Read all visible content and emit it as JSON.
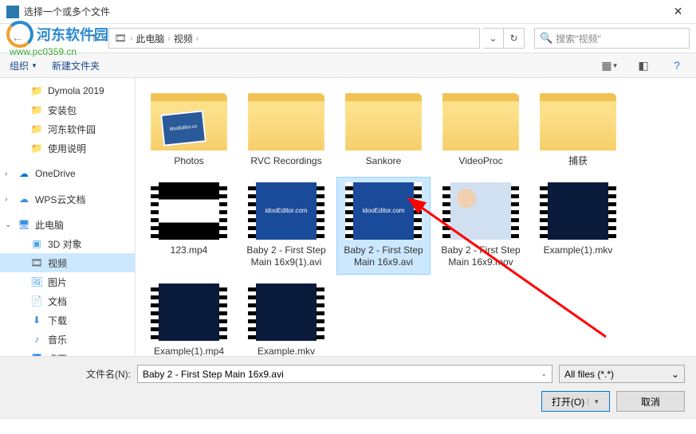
{
  "window": {
    "title": "选择一个或多个文件"
  },
  "watermark": {
    "brand": "河东软件园",
    "url": "www.pc0359.cn"
  },
  "address": {
    "seg1": "此电脑",
    "seg2": "视频",
    "search_placeholder": "搜索\"视频\""
  },
  "toolbar": {
    "organize": "组织",
    "newfolder": "新建文件夹"
  },
  "sidebar": {
    "items": [
      {
        "label": "Dymola 2019",
        "icon": "folder",
        "indent": true,
        "chev": ""
      },
      {
        "label": "安装包",
        "icon": "folder",
        "indent": true,
        "chev": ""
      },
      {
        "label": "河东软件园",
        "icon": "folder",
        "indent": true,
        "chev": ""
      },
      {
        "label": "使用说明",
        "icon": "folder",
        "indent": true,
        "chev": ""
      },
      {
        "label": "OneDrive",
        "icon": "onedrive",
        "indent": false,
        "chev": "›"
      },
      {
        "label": "WPS云文档",
        "icon": "wps",
        "indent": false,
        "chev": "›"
      },
      {
        "label": "此电脑",
        "icon": "pc",
        "indent": false,
        "chev": "⌄"
      },
      {
        "label": "3D 对象",
        "icon": "obj3d",
        "indent": true,
        "chev": ""
      },
      {
        "label": "视频",
        "icon": "video",
        "indent": true,
        "chev": "",
        "sel": true
      },
      {
        "label": "图片",
        "icon": "pic",
        "indent": true,
        "chev": ""
      },
      {
        "label": "文档",
        "icon": "doc",
        "indent": true,
        "chev": ""
      },
      {
        "label": "下载",
        "icon": "dl",
        "indent": true,
        "chev": ""
      },
      {
        "label": "音乐",
        "icon": "music",
        "indent": true,
        "chev": ""
      },
      {
        "label": "桌面",
        "icon": "desktop",
        "indent": true,
        "chev": ""
      }
    ]
  },
  "files": [
    {
      "label": "Photos",
      "type": "folder",
      "preview": "idooEditor.co"
    },
    {
      "label": "RVC Recordings",
      "type": "folder-plain"
    },
    {
      "label": "Sankore",
      "type": "folder-plain"
    },
    {
      "label": "VideoProc",
      "type": "folder",
      "preview": ""
    },
    {
      "label": "捕获",
      "type": "folder-plain"
    },
    {
      "label": "123.mp4",
      "type": "video-light"
    },
    {
      "label": "Baby 2 - First Step Main 16x9(1).avi",
      "type": "video-idoo",
      "preview": "idooEditor.com"
    },
    {
      "label": "Baby 2 - First Step Main 16x9.avi",
      "type": "video-idoo",
      "preview": "idooEditor.com",
      "sel": true
    },
    {
      "label": "Baby 2 - First Step Main 16x9.mov",
      "type": "video-baby"
    },
    {
      "label": "Example(1).mkv",
      "type": "video-dark"
    },
    {
      "label": "Example(1).mp4",
      "type": "video-dark"
    },
    {
      "label": "Example.mkv",
      "type": "video-dark"
    }
  ],
  "bottom": {
    "filename_label": "文件名(N):",
    "filename_value": "Baby 2 - First Step Main 16x9.avi",
    "filter": "All files (*.*)",
    "open": "打开(O)",
    "cancel": "取消"
  },
  "icons": {
    "folder": "📁",
    "onedrive": "☁",
    "wps": "☁",
    "pc": "🖥",
    "obj3d": "▣",
    "video": "🎞",
    "pic": "🖼",
    "doc": "📄",
    "dl": "⬇",
    "music": "♪",
    "desktop": "🖥"
  }
}
